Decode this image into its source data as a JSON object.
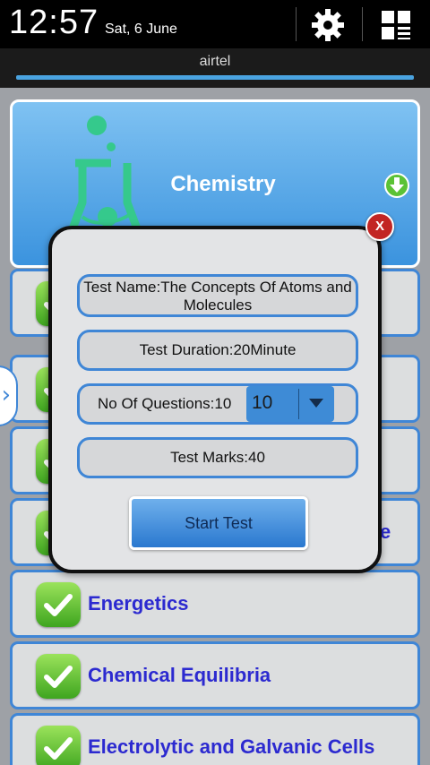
{
  "status_bar": {
    "time": "12:57",
    "date": "Sat, 6 June",
    "icons": [
      "gear-icon",
      "quick-settings-icon"
    ]
  },
  "carrier": "airtel",
  "header": {
    "title": "Chemistry",
    "icons": [
      "flask-icon",
      "download-icon"
    ]
  },
  "list": {
    "items": [
      {
        "label": ""
      },
      {
        "label": ""
      },
      {
        "label": ""
      },
      {
        "label": "",
        "partial": "e"
      },
      {
        "label": "Energetics"
      },
      {
        "label": "Chemical Equilibria"
      },
      {
        "label": "Electrolytic and Galvanic Cells"
      }
    ]
  },
  "dialog": {
    "close_label": "X",
    "test_name": "Test Name:The Concepts Of Atoms and Molecules",
    "test_duration": "Test Duration:20Minute",
    "questions_label": "No Of Questions:10",
    "questions_selected": "10",
    "test_marks": "Test Marks:40",
    "start_label": "Start Test"
  },
  "colors": {
    "accent": "#3f86d6",
    "header_gradient_top": "#7fc2f2",
    "header_gradient_bottom": "#3b93de",
    "check_green": "#4cb825",
    "item_text": "#2c2ad0",
    "close_red": "#c22523",
    "app_background": "#9ea1a6"
  }
}
